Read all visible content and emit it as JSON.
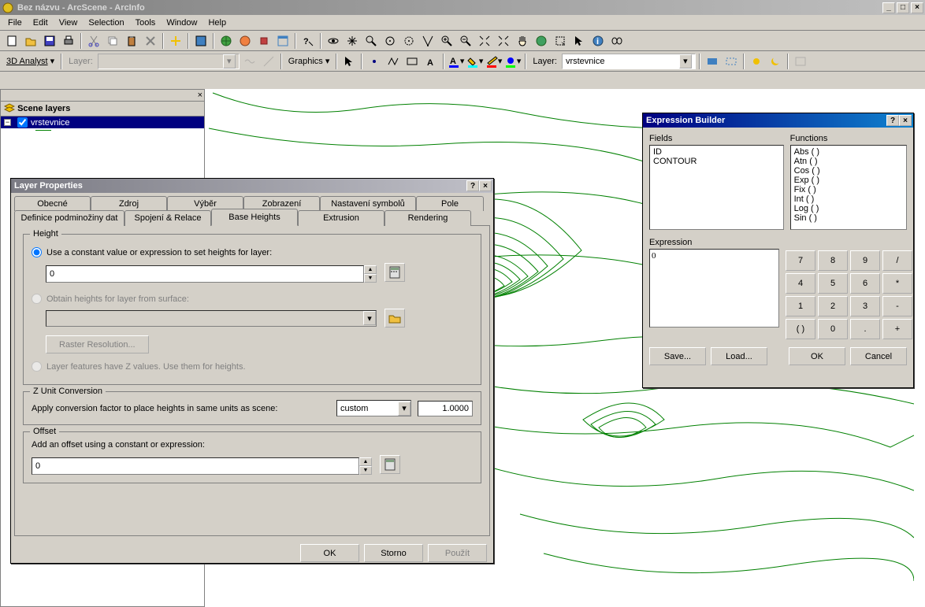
{
  "window": {
    "title": "Bez názvu - ArcScene - ArcInfo"
  },
  "menu": [
    "File",
    "Edit",
    "View",
    "Selection",
    "Tools",
    "Window",
    "Help"
  ],
  "toolbar2": {
    "analyst_label": "3D Analyst",
    "layer_label": "Layer:",
    "graphics_label": "Graphics",
    "layer2_label": "Layer:",
    "layer2_value": "vrstevnice"
  },
  "toc": {
    "title": "Scene layers",
    "item_name": "vrstevnice"
  },
  "layerprops": {
    "title": "Layer Properties",
    "tabs_row1": [
      "Obecné",
      "Zdroj",
      "Výběr",
      "Zobrazení",
      "Nastavení symbolů",
      "Pole"
    ],
    "tabs_row2": [
      "Definice podminožiny dat",
      "Spojení & Relace",
      "Base Heights",
      "Extrusion",
      "Rendering"
    ],
    "height_legend": "Height",
    "radio_const": "Use a constant value or expression to set heights for layer:",
    "const_value": "0",
    "radio_surface": "Obtain heights for layer from surface:",
    "raster_btn": "Raster Resolution...",
    "radio_z": "Layer features have Z values.  Use them for heights.",
    "zconv_legend": "Z Unit Conversion",
    "zconv_text": "Apply conversion factor to place heights in same units as scene:",
    "zconv_mode": "custom",
    "zconv_value": "1.0000",
    "offset_legend": "Offset",
    "offset_text": "Add an offset using a constant or expression:",
    "offset_value": "0",
    "btn_ok": "OK",
    "btn_cancel": "Storno",
    "btn_apply": "Použít"
  },
  "expr": {
    "title": "Expression Builder",
    "fields_label": "Fields",
    "fields": [
      "ID",
      "CONTOUR"
    ],
    "functions_label": "Functions",
    "functions": [
      "Abs ( )",
      "Atn ( )",
      "Cos ( )",
      "Exp ( )",
      "Fix ( )",
      "Int ( )",
      "Log ( )",
      "Sin ( )"
    ],
    "expression_label": "Expression",
    "expression_value": "0",
    "keypad": [
      "7",
      "8",
      "9",
      "/",
      "4",
      "5",
      "6",
      "*",
      "1",
      "2",
      "3",
      "-",
      "( )",
      "0",
      ".",
      "+"
    ],
    "btn_save": "Save...",
    "btn_load": "Load...",
    "btn_ok": "OK",
    "btn_cancel": "Cancel"
  }
}
